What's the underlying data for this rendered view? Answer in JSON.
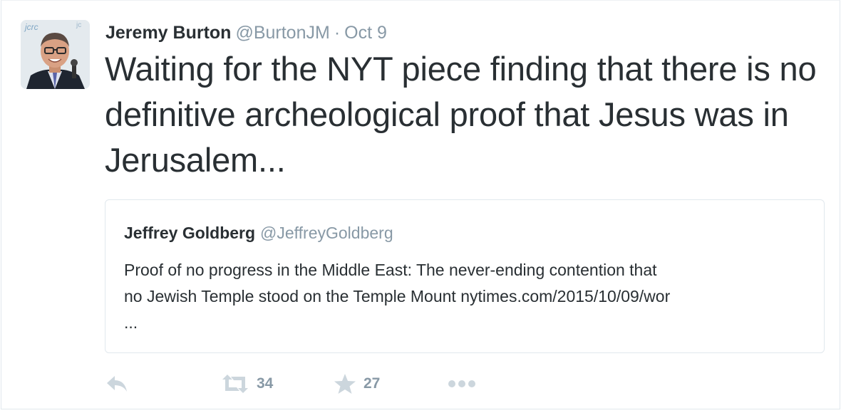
{
  "tweet": {
    "author_name": "Jeremy Burton",
    "author_handle": "@BurtonJM",
    "separator": "·",
    "date": "Oct 9",
    "text": "Waiting for the NYT piece finding that there is no definitive archeological proof that Jesus was in Jerusalem...",
    "avatar_backdrop_text": "jcrc"
  },
  "quoted_tweet": {
    "author_name": "Jeffrey Goldberg",
    "author_handle": "@JeffreyGoldberg",
    "text_line1": "Proof of no progress in the Middle East: The never-ending contention that",
    "text_line2": "no Jewish Temple stood on the Temple Mount nytimes.com/2015/10/09/wor",
    "text_line3": "..."
  },
  "actions": {
    "reply_icon": "reply-icon",
    "retweet_icon": "retweet-icon",
    "retweet_count": "34",
    "favorite_icon": "star-icon",
    "favorite_count": "27",
    "more_icon": "more-dots-icon"
  },
  "colors": {
    "text": "#292f33",
    "muted": "#8899a6",
    "icon": "#ccd6dd",
    "border": "#e1e8ed"
  }
}
